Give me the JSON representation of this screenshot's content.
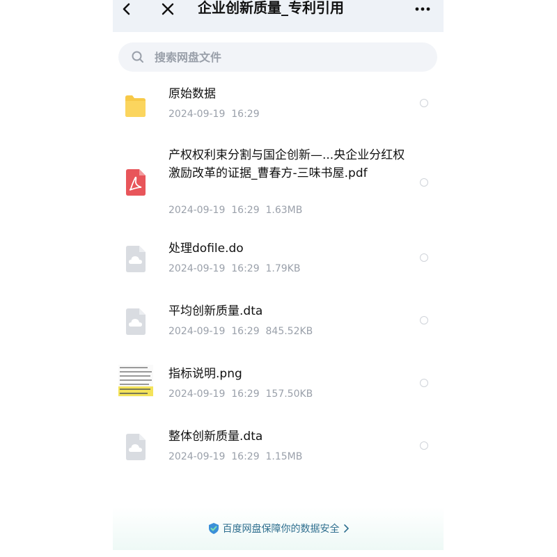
{
  "header": {
    "title": "企业创新质量_专利引用",
    "back_icon": "chevron-left-icon",
    "close_icon": "close-icon",
    "more_icon": "more-horizontal-icon"
  },
  "search": {
    "placeholder": "搜索网盘文件",
    "value": ""
  },
  "files": [
    {
      "name": "原始数据",
      "meta": "2024-09-19  16:29",
      "type": "folder",
      "icon": "folder-icon"
    },
    {
      "name": "产权权利束分割与国企创新—...央企业分红权激励改革的证据_曹春方-三味书屋.pdf",
      "meta": "2024-09-19  16:29  1.63MB",
      "type": "pdf",
      "icon": "pdf-icon"
    },
    {
      "name": "处理dofile.do",
      "meta": "2024-09-19  16:29  1.79KB",
      "type": "cloud-file",
      "icon": "cloud-file-icon"
    },
    {
      "name": "平均创新质量.dta",
      "meta": "2024-09-19  16:29  845.52KB",
      "type": "cloud-file",
      "icon": "cloud-file-icon"
    },
    {
      "name": "指标说明.png",
      "meta": "2024-09-19  16:29  157.50KB",
      "type": "image",
      "icon": "image-thumbnail"
    },
    {
      "name": "整体创新质量.dta",
      "meta": "2024-09-19  16:29  1.15MB",
      "type": "cloud-file",
      "icon": "cloud-file-icon"
    }
  ],
  "footer": {
    "text": "百度网盘保障你的数据安全",
    "icon": "shield-icon"
  },
  "colors": {
    "header_bg": "#eef2f7",
    "folder": "#f7c948",
    "pdf": "#e8555a",
    "footer_text": "#2f6f8f"
  }
}
